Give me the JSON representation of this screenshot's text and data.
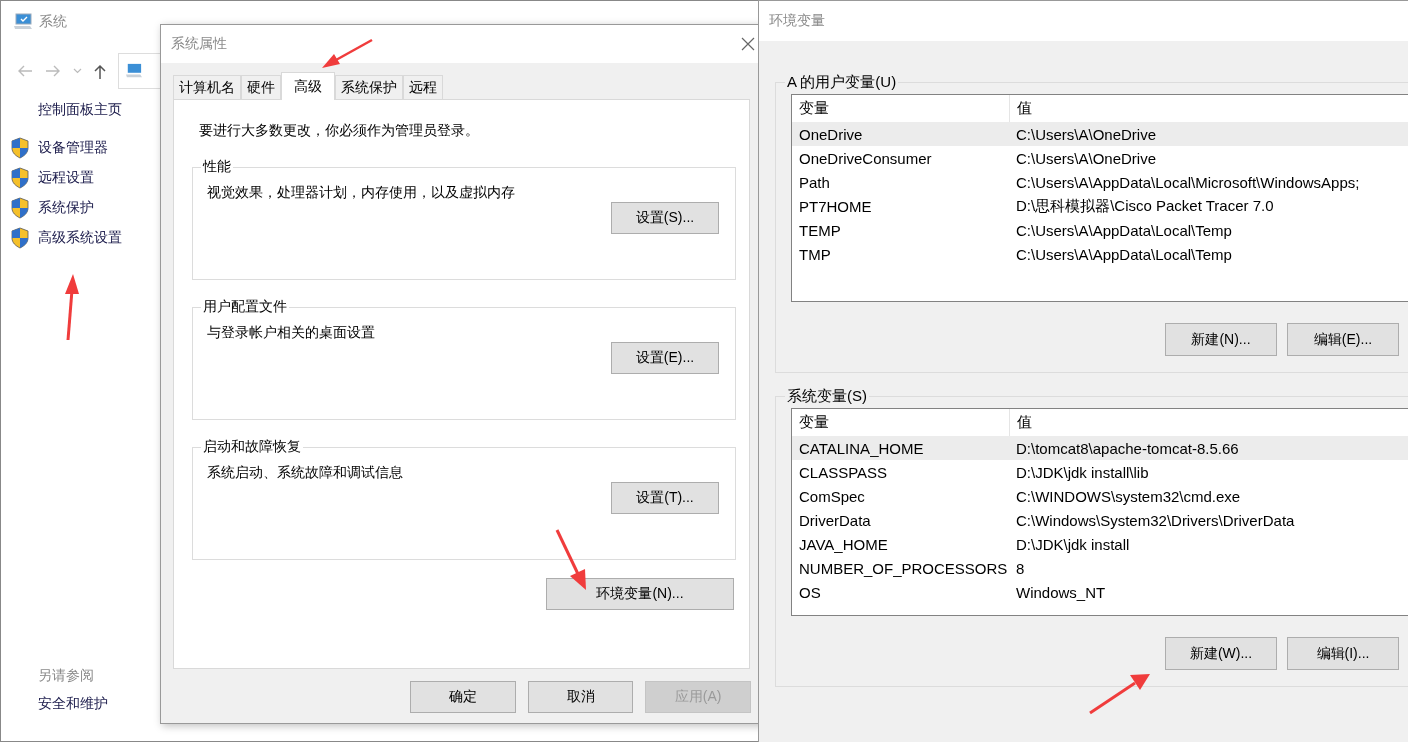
{
  "system_window": {
    "title": "系统",
    "sidebar": {
      "home": "控制面板主页",
      "items": [
        "设备管理器",
        "远程设置",
        "系统保护",
        "高级系统设置"
      ]
    },
    "see_also": {
      "heading": "另请参阅",
      "links": [
        "安全和维护"
      ]
    }
  },
  "system_properties": {
    "title": "系统属性",
    "tabs": [
      {
        "label": "计算机名",
        "selected": false
      },
      {
        "label": "硬件",
        "selected": false
      },
      {
        "label": "高级",
        "selected": true
      },
      {
        "label": "系统保护",
        "selected": false
      },
      {
        "label": "远程",
        "selected": false
      }
    ],
    "notice": "要进行大多数更改，你必须作为管理员登录。",
    "groups": [
      {
        "title": "性能",
        "description": "视觉效果，处理器计划，内存使用，以及虚拟内存",
        "button": "设置(S)..."
      },
      {
        "title": "用户配置文件",
        "description": "与登录帐户相关的桌面设置",
        "button": "设置(E)..."
      },
      {
        "title": "启动和故障恢复",
        "description": "系统启动、系统故障和调试信息",
        "button": "设置(T)..."
      }
    ],
    "env_button": "环境变量(N)...",
    "buttons": [
      {
        "label": "确定",
        "disabled": false
      },
      {
        "label": "取消",
        "disabled": false
      },
      {
        "label": "应用(A)",
        "disabled": true
      }
    ]
  },
  "environment_variables": {
    "title": "环境变量",
    "sections": [
      {
        "title": "A 的用户变量(U)",
        "columns": [
          "变量",
          "值"
        ],
        "rows": [
          {
            "name": "OneDrive",
            "value": "C:\\Users\\A\\OneDrive",
            "selected": true
          },
          {
            "name": "OneDriveConsumer",
            "value": "C:\\Users\\A\\OneDrive",
            "selected": false
          },
          {
            "name": "Path",
            "value": "C:\\Users\\A\\AppData\\Local\\Microsoft\\WindowsApps;",
            "selected": false
          },
          {
            "name": "PT7HOME",
            "value": "D:\\思科模拟器\\Cisco Packet Tracer 7.0",
            "selected": false
          },
          {
            "name": "TEMP",
            "value": "C:\\Users\\A\\AppData\\Local\\Temp",
            "selected": false
          },
          {
            "name": "TMP",
            "value": "C:\\Users\\A\\AppData\\Local\\Temp",
            "selected": false
          }
        ],
        "buttons": [
          "新建(N)...",
          "编辑(E)..."
        ]
      },
      {
        "title": "系统变量(S)",
        "columns": [
          "变量",
          "值"
        ],
        "rows": [
          {
            "name": "CATALINA_HOME",
            "value": "D:\\tomcat8\\apache-tomcat-8.5.66",
            "selected": true
          },
          {
            "name": "CLASSPASS",
            "value": "D:\\JDK\\jdk install\\lib",
            "selected": false
          },
          {
            "name": "ComSpec",
            "value": "C:\\WINDOWS\\system32\\cmd.exe",
            "selected": false
          },
          {
            "name": "DriverData",
            "value": "C:\\Windows\\System32\\Drivers\\DriverData",
            "selected": false
          },
          {
            "name": "JAVA_HOME",
            "value": "D:\\JDK\\jdk install",
            "selected": false
          },
          {
            "name": "NUMBER_OF_PROCESSORS",
            "value": "8",
            "selected": false
          },
          {
            "name": "OS",
            "value": "Windows_NT",
            "selected": false
          }
        ],
        "buttons": [
          "新建(W)...",
          "编辑(I)..."
        ]
      }
    ]
  }
}
